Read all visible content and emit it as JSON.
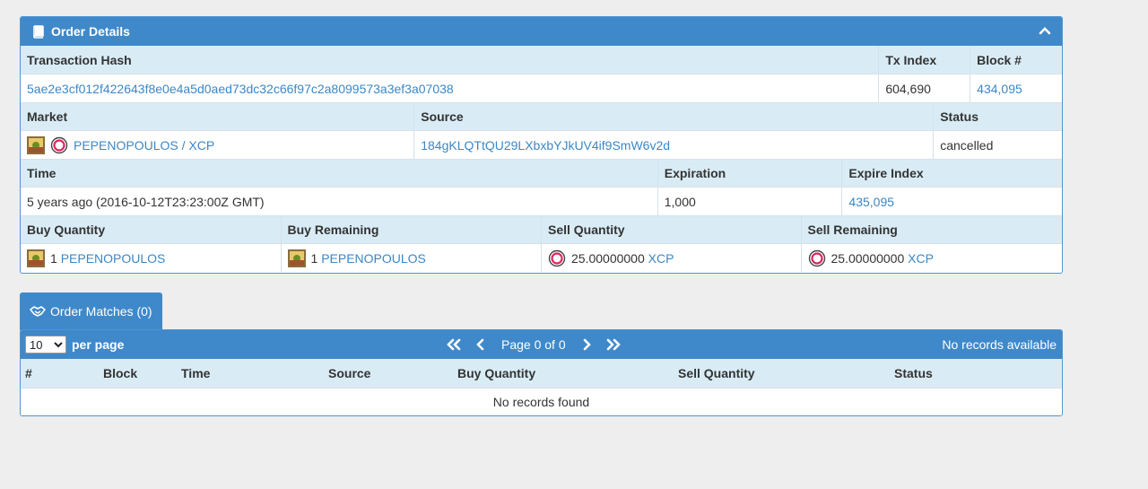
{
  "order": {
    "title": "Order Details",
    "tx_hash_label": "Transaction Hash",
    "tx_hash": "5ae2e3cf012f422643f8e0e4a5d0aed73dc32c66f97c2a8099573a3ef3a07038",
    "tx_index_label": "Tx Index",
    "tx_index": "604,690",
    "block_label": "Block #",
    "block": "434,095",
    "market_label": "Market",
    "market": "PEPENOPOULOS / XCP",
    "source_label": "Source",
    "source": "184gKLQTtQU29LXbxbYJkUV4if9SmW6v2d",
    "status_label": "Status",
    "status": "cancelled",
    "time_label": "Time",
    "time": "5 years ago (2016-10-12T23:23:00Z GMT)",
    "expiration_label": "Expiration",
    "expiration": "1,000",
    "expire_index_label": "Expire Index",
    "expire_index": "435,095",
    "buy_qty_label": "Buy Quantity",
    "buy_qty_amount": "1",
    "buy_qty_asset": "PEPENOPOULOS",
    "buy_rem_label": "Buy Remaining",
    "buy_rem_amount": "1",
    "buy_rem_asset": "PEPENOPOULOS",
    "sell_qty_label": "Sell Quantity",
    "sell_qty_amount": "25.00000000",
    "sell_qty_asset": "XCP",
    "sell_rem_label": "Sell Remaining",
    "sell_rem_amount": "25.00000000",
    "sell_rem_asset": "XCP"
  },
  "matches": {
    "tab_label": "Order Matches (0)",
    "per_page_value": "10",
    "per_page_options": [
      "10"
    ],
    "per_page_label": "per page",
    "page_label": "Page 0 of 0",
    "no_records_available": "No records available",
    "columns": [
      "#",
      "Block",
      "Time",
      "Source",
      "Buy Quantity",
      "Sell Quantity",
      "Status"
    ],
    "empty_text": "No records found"
  },
  "colors": {
    "header_blue": "#3f89ca",
    "header_light": "#d9ecf6",
    "link": "#3c87c6",
    "xcp_red": "#e0245e"
  },
  "icons": {
    "order_title": "book-icon",
    "collapse": "chevron-up-icon",
    "matches_tab": "handshake-icon"
  }
}
